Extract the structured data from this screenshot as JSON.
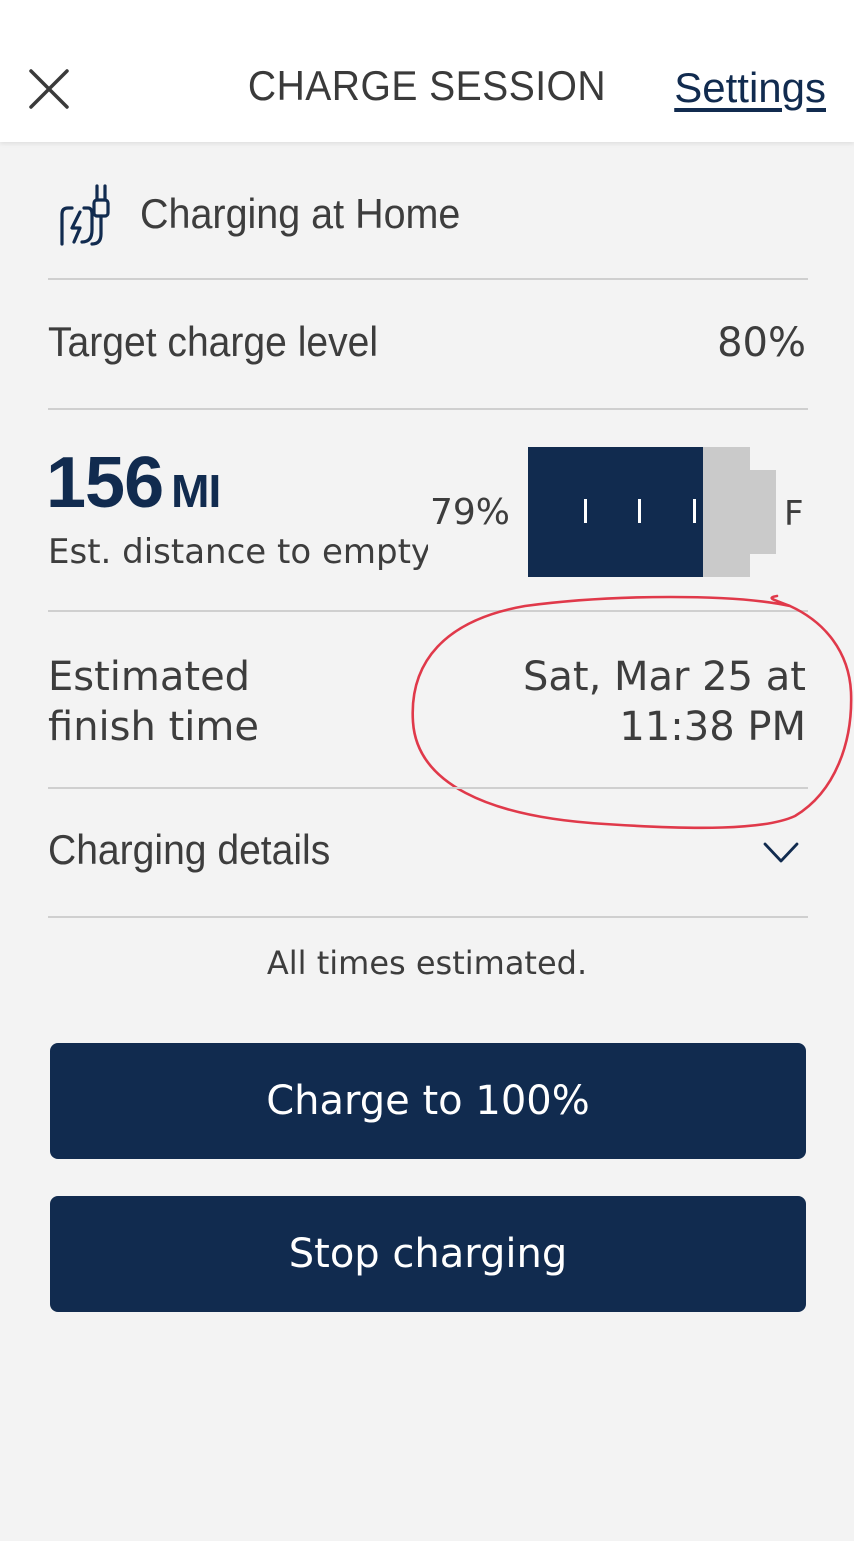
{
  "header": {
    "title": "CHARGE SESSION",
    "settings_label": "Settings"
  },
  "location": {
    "label": "Charging at Home"
  },
  "target": {
    "label": "Target charge level",
    "value": "80%"
  },
  "range": {
    "value": "156",
    "unit": "MI",
    "caption": "Est. distance to empty"
  },
  "battery": {
    "percent_label": "79%",
    "level": 0.79,
    "full_label": "F"
  },
  "finish": {
    "label_line1": "Estimated",
    "label_line2": "finish time",
    "value_line1": "Sat, Mar 25 at",
    "value_line2": "11:38 PM"
  },
  "details": {
    "label": "Charging details"
  },
  "note": "All times estimated.",
  "buttons": {
    "charge_full": "Charge to 100%",
    "stop": "Stop charging"
  },
  "colors": {
    "brand": "#112b4f",
    "annotation": "#e0394a"
  },
  "icons": [
    "close-icon",
    "ev-plug-icon",
    "chevron-down-icon"
  ]
}
